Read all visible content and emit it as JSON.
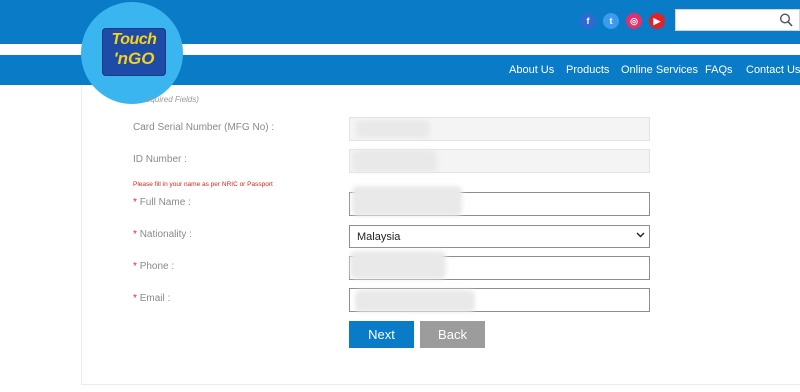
{
  "header": {
    "social": [
      {
        "name": "facebook",
        "glyph": "f",
        "color": "#2e6ad0"
      },
      {
        "name": "twitter",
        "glyph": "t",
        "color": "#3c9bee"
      },
      {
        "name": "instagram",
        "glyph": "◎",
        "color": "#e1306c"
      },
      {
        "name": "youtube",
        "glyph": "▶",
        "color": "#e0222a"
      }
    ],
    "search": {
      "value": "",
      "placeholder": ""
    }
  },
  "logo": {
    "line1": "Touch",
    "line2": "'nGO"
  },
  "nav": {
    "items": [
      {
        "label": "About Us"
      },
      {
        "label": "Products"
      },
      {
        "label": "Online Services"
      },
      {
        "label": "FAQs"
      },
      {
        "label": "Contact Us"
      }
    ]
  },
  "form": {
    "required_note": "equired Fields)",
    "asterisk": "*",
    "card_serial": {
      "label": "Card Serial Number (MFG No) :",
      "value": ""
    },
    "id_number": {
      "label": "ID Number :",
      "value": ""
    },
    "name_note": "Please fill in your name as per NRIC or Passport",
    "full_name": {
      "label": "Full Name :",
      "value": ""
    },
    "nationality": {
      "label": "Nationality :",
      "selected": "Malaysia"
    },
    "phone": {
      "label": "Phone :",
      "value": ""
    },
    "email": {
      "label": "Email :",
      "value": ""
    }
  },
  "buttons": {
    "next": "Next",
    "back": "Back"
  },
  "colors": {
    "brand_blue": "#0a7bc6",
    "logo_circle": "#3bb5ef",
    "required_red": "#e2231a",
    "back_gray": "#9c9c9c"
  }
}
